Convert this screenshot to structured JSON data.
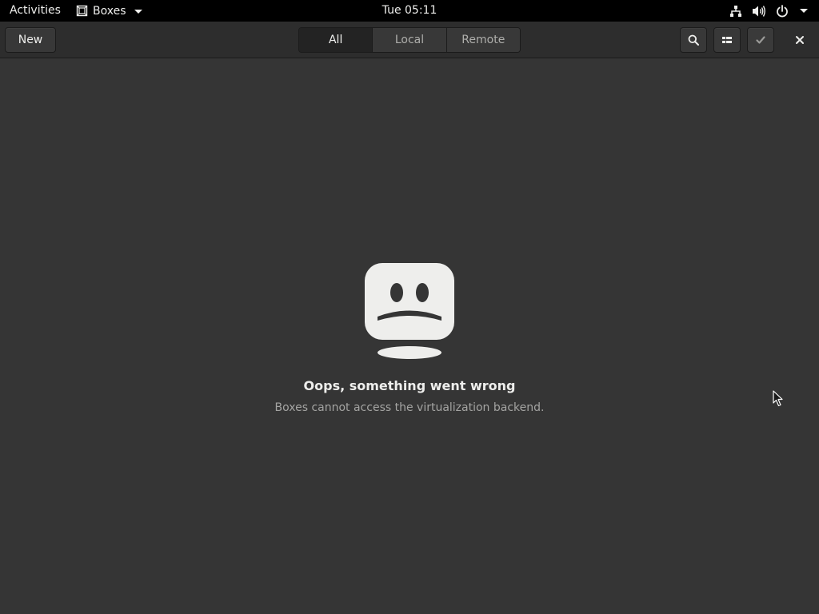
{
  "topbar": {
    "activities": "Activities",
    "app_name": "Boxes",
    "clock": "Tue 05:11",
    "icons": [
      "network-icon",
      "volume-icon",
      "power-icon",
      "chevron-down-icon"
    ]
  },
  "headerbar": {
    "new_label": "New",
    "filters": [
      {
        "label": "All",
        "active": true
      },
      {
        "label": "Local",
        "active": false
      },
      {
        "label": "Remote",
        "active": false
      }
    ],
    "icons": [
      "search-icon",
      "list-view-icon",
      "checkmark-icon",
      "close-icon"
    ]
  },
  "error": {
    "icon": "sad-computer-icon",
    "title": "Oops, something went wrong",
    "subtitle": "Boxes cannot access the virtualization backend."
  },
  "colors": {
    "topbar_bg": "#000000",
    "headerbar_bg": "#2d2d2d",
    "content_bg": "#353535",
    "text_primary": "#eeeeec",
    "text_secondary": "#a4a4a2",
    "icon_face": "#eeeeec"
  }
}
